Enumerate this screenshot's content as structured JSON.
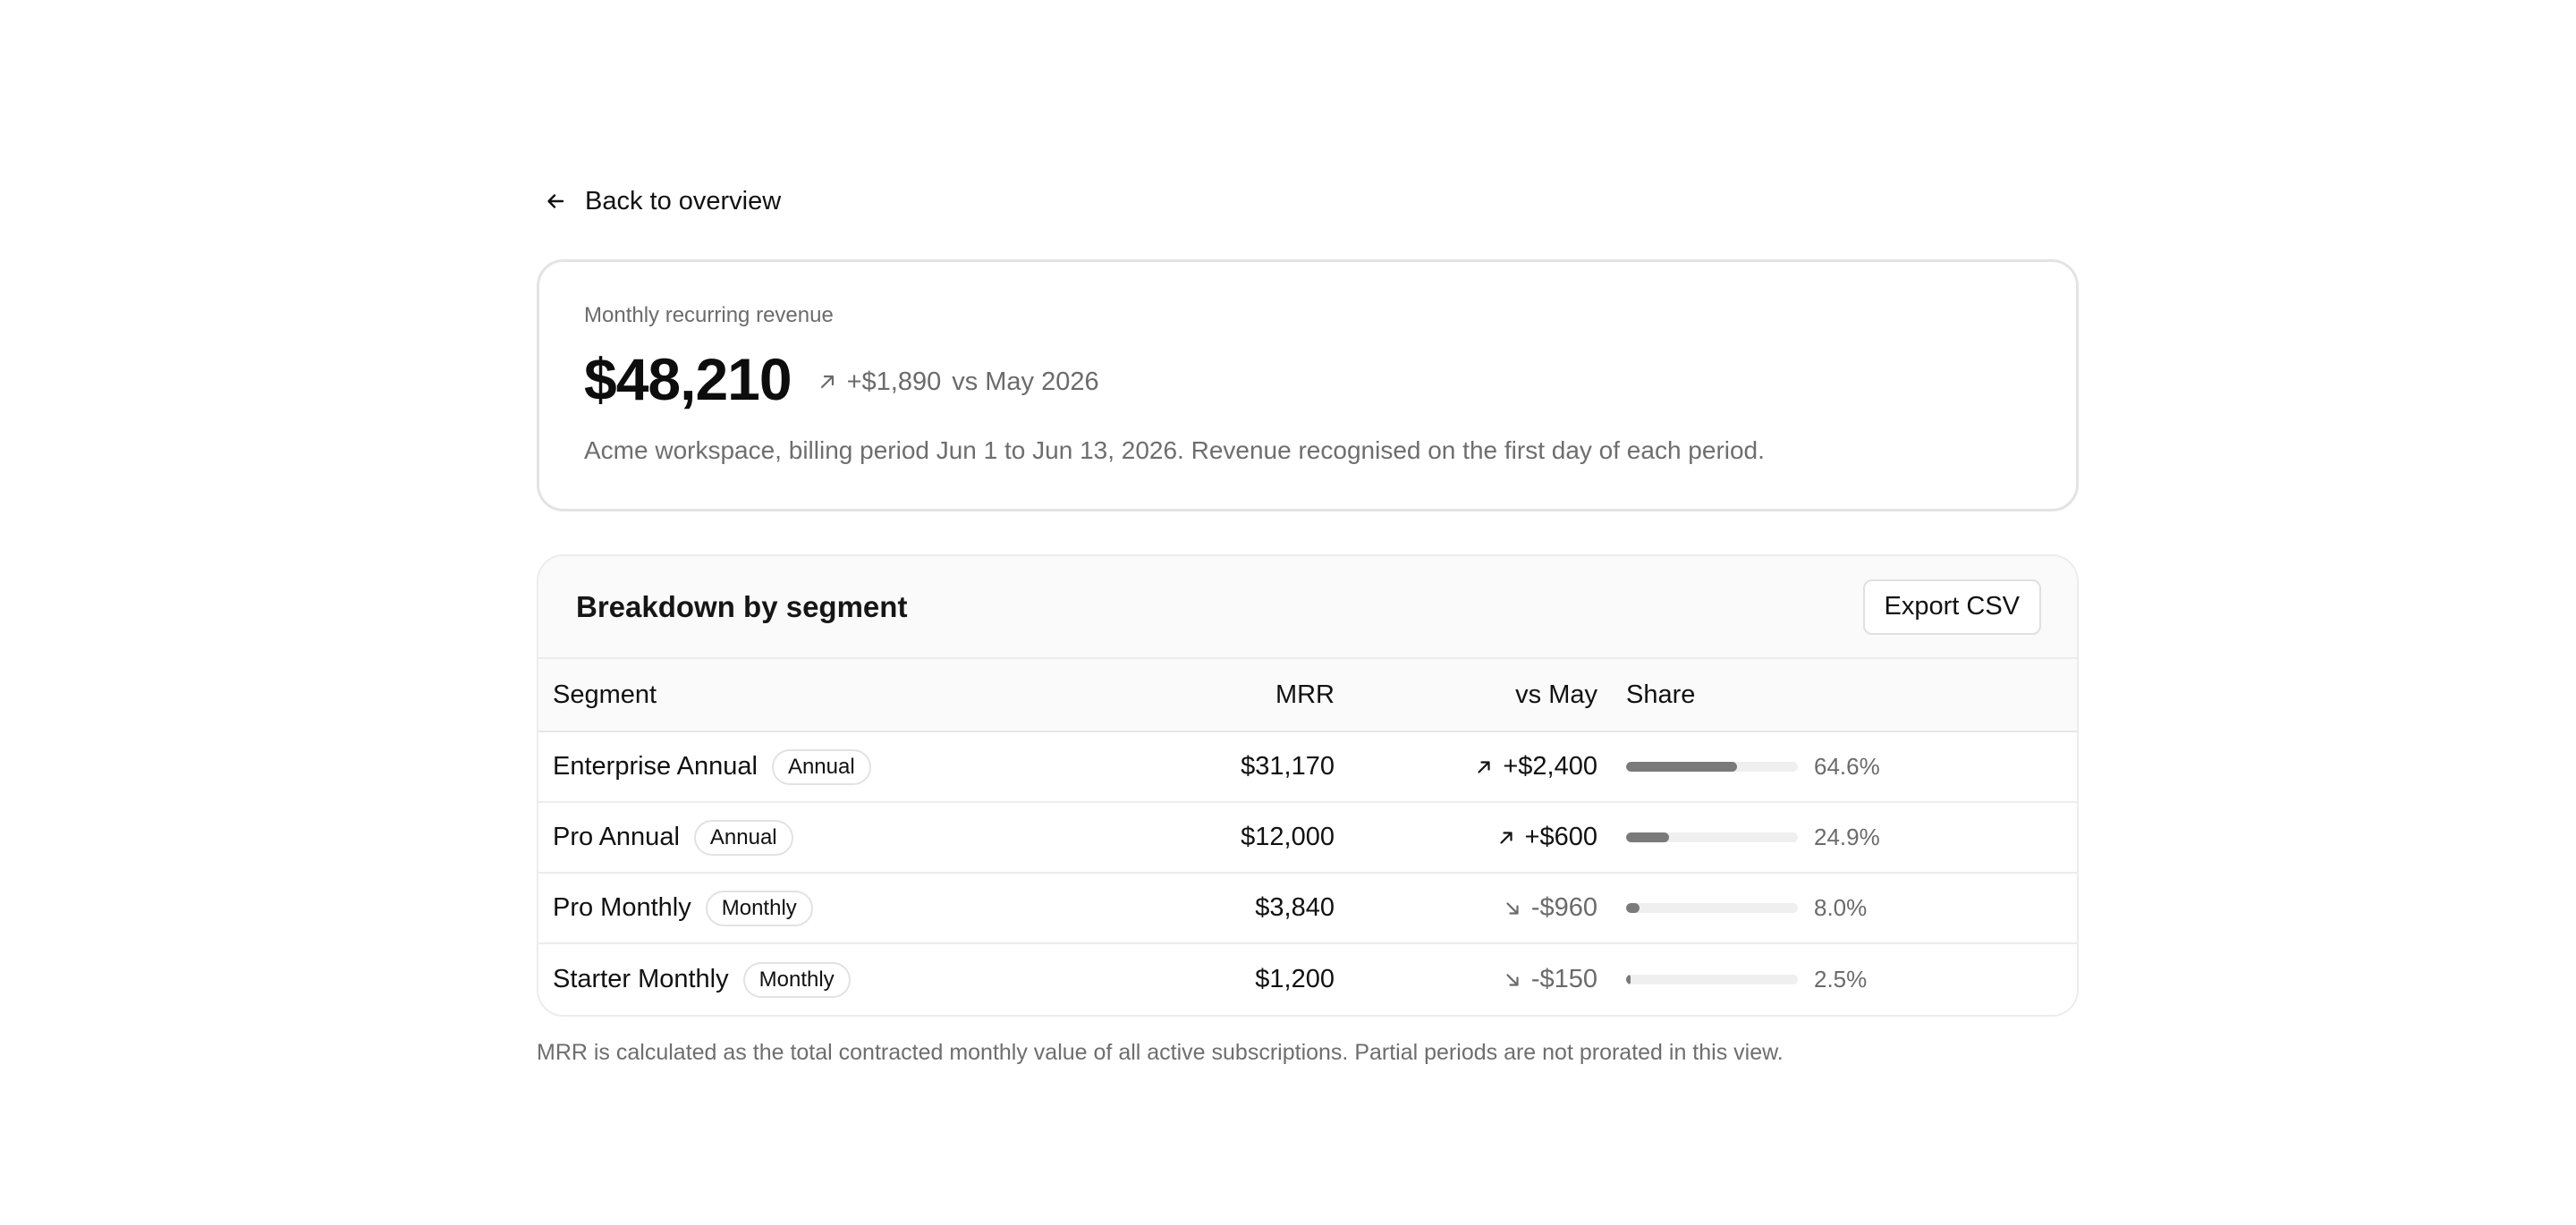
{
  "back": {
    "label": "Back to overview"
  },
  "summary": {
    "eyebrow": "Monthly recurring revenue",
    "value": "$48,210",
    "delta": "+$1,890",
    "delta_context": "vs May 2026",
    "description": "Acme workspace, billing period Jun 1 to Jun 13, 2026. Revenue recognised on the first day of each period."
  },
  "breakdown": {
    "title": "Breakdown by segment",
    "export_label": "Export CSV",
    "columns": {
      "segment": "Segment",
      "mrr": "MRR",
      "vs": "vs May",
      "share": "Share"
    },
    "rows": [
      {
        "segment": "Enterprise Annual",
        "badge": "Annual",
        "mrr": "$31,170",
        "vs": "+$2,400",
        "direction": "up",
        "share": "64.6%",
        "share_value": 64.6
      },
      {
        "segment": "Pro Annual",
        "badge": "Annual",
        "mrr": "$12,000",
        "vs": "+$600",
        "direction": "up",
        "share": "24.9%",
        "share_value": 24.9
      },
      {
        "segment": "Pro Monthly",
        "badge": "Monthly",
        "mrr": "$3,840",
        "vs": "-$960",
        "direction": "down",
        "share": "8.0%",
        "share_value": 8.0
      },
      {
        "segment": "Starter Monthly",
        "badge": "Monthly",
        "mrr": "$1,200",
        "vs": "-$150",
        "direction": "down",
        "share": "2.5%",
        "share_value": 2.5
      }
    ]
  },
  "footnote": "MRR is calculated as the total contracted monthly value of all active subscriptions. Partial periods are not prorated in this view.",
  "icons": {
    "back": "arrow-left-icon",
    "up": "arrow-up-right-icon",
    "down": "arrow-down-right-icon"
  },
  "colors": {
    "bar_fill": "#7a7a7a",
    "bar_track": "#efefef",
    "muted": "#6b6b6b"
  }
}
